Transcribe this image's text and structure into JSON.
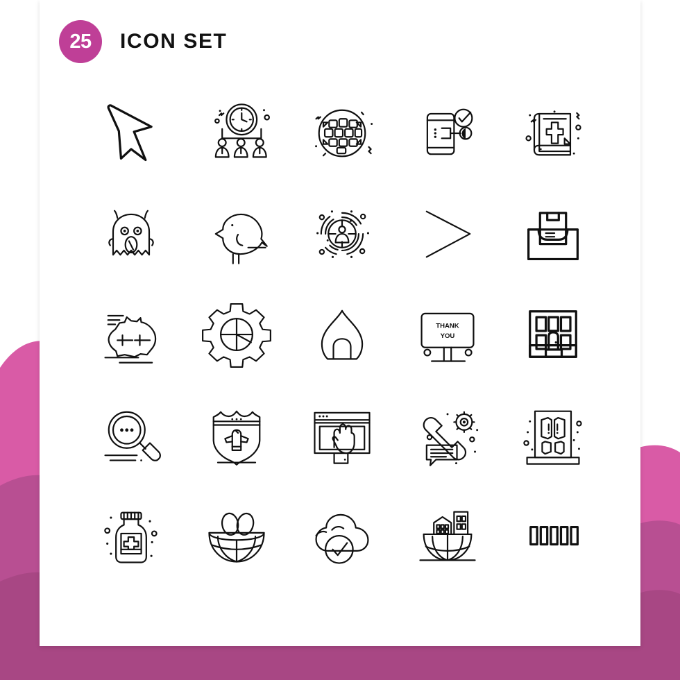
{
  "header": {
    "count": "25",
    "title": "ICON SET"
  },
  "colors": {
    "brand_magenta": "#bf3f97",
    "bg_pink_light": "#d95ba6",
    "bg_pink_mid": "#b84f92",
    "bg_pink_dark": "#a84784",
    "card_white": "#ffffff",
    "icon_stroke": "#101010"
  },
  "icons": [
    {
      "id": "arrow-cursor",
      "label": "Arrow Cursor"
    },
    {
      "id": "clock-team",
      "label": "Clock Team Meeting"
    },
    {
      "id": "waffle-grid-circle",
      "label": "Waffle Grid Circle"
    },
    {
      "id": "mobile-verified",
      "label": "Mobile Verified"
    },
    {
      "id": "holy-bible",
      "label": "Holy Bible"
    },
    {
      "id": "ghost-monster",
      "label": "Ghost Monster"
    },
    {
      "id": "bird",
      "label": "Bird"
    },
    {
      "id": "user-target",
      "label": "User Target"
    },
    {
      "id": "chevron-right",
      "label": "Chevron Right"
    },
    {
      "id": "package-tray",
      "label": "Package Tray"
    },
    {
      "id": "australia-map",
      "label": "Australia Map"
    },
    {
      "id": "gear-settings",
      "label": "Gear Settings"
    },
    {
      "id": "hut-dome",
      "label": "Hut Dome"
    },
    {
      "id": "thank-you-billboard",
      "label": "Thank You Billboard"
    },
    {
      "id": "apartment-building",
      "label": "Apartment Building"
    },
    {
      "id": "magnifier-search",
      "label": "Magnifier Search"
    },
    {
      "id": "police-badge",
      "label": "Police Badge"
    },
    {
      "id": "browser-hand",
      "label": "Browser Hand"
    },
    {
      "id": "phone-support-gear",
      "label": "Phone Support Gear"
    },
    {
      "id": "double-door",
      "label": "Double Door"
    },
    {
      "id": "medicine-bottle",
      "label": "Medicine Bottle"
    },
    {
      "id": "nest-eggs",
      "label": "Nest With Eggs"
    },
    {
      "id": "cloud-check",
      "label": "Cloud Check"
    },
    {
      "id": "global-city",
      "label": "Global City"
    },
    {
      "id": "bar-code",
      "label": "Bar Code"
    }
  ],
  "billboard": {
    "line1": "THANK",
    "line2": "YOU"
  }
}
